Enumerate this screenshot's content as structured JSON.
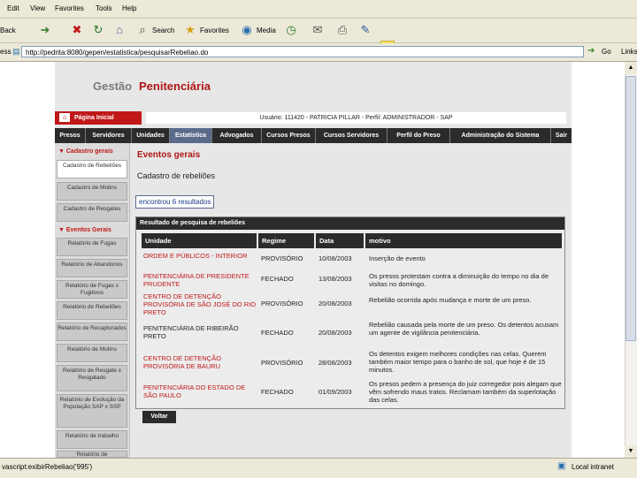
{
  "browser": {
    "menu": [
      "Edit",
      "View",
      "Favorites",
      "Tools",
      "Help"
    ],
    "toolbar": {
      "back_label": "Back",
      "search_label": "Search",
      "favorites_label": "Favorites",
      "media_label": "Media"
    },
    "address": {
      "label": "ess",
      "url": "http://pedrita:8080/gepen/estatistica/pesquisarRebeliao.do",
      "go_label": "Go",
      "links_label": "Links"
    },
    "status": {
      "text": "vascript:exibirRebeliao('995')",
      "zone": "Local intranet"
    }
  },
  "site": {
    "logo_gray": "Gestão",
    "logo_red": "Penitenciária",
    "home_label": "Página Inicial",
    "user_info": "Usuário: 111420 - PATRICIA PILLAR - Perfil: ADMINISTRADOR - SAP",
    "nav": [
      "Presos",
      "Servidores",
      "Unidades",
      "Estatística",
      "Advogados",
      "Cursos Presos",
      "Cursos Servidores",
      "Perfil do Preso",
      "Administração do Sistema",
      "Sair"
    ],
    "sidebar": {
      "section1": "Cadastro gerais",
      "section1_items": [
        "Cadastro de Rebeliões",
        "Cadastro de Motins",
        "Cadastro de Resgates"
      ],
      "section2": "Eventos Gerais",
      "section2_items": [
        "Relatório de Fugas",
        "Relatório de Abandonos",
        "Relatório de Fugas x Fugitivos",
        "Relatório de Rebeliões",
        "Relatório de Recapturados",
        "Relatório de Motins",
        "Relatório de Resgate x Resgatado",
        "Relatório de Evolução da População SAP x SSP",
        "Relatório de trabalho",
        "Relatório de"
      ]
    },
    "content": {
      "section_title": "Eventos gerais",
      "subtitle": "Cadastro de rebeliões",
      "found": "encontrou 6 resultados",
      "results_header": "Resultado de pesquisa de rebeliões",
      "columns": [
        "Unidade",
        "Regime",
        "Data",
        "motivo"
      ],
      "rows": [
        {
          "unidade": "ORDEM E PÚBLICOS - INTERIOR",
          "regime": "PROVISÓRIO",
          "data": "10/08/2003",
          "motivo": "Inserção de evento"
        },
        {
          "unidade": "PENITENCIÁRIA DE PRESIDENTE PRUDENTE",
          "regime": "FECHADO",
          "data": "13/08/2003",
          "motivo": "Os presos protestam contra a diminuição do tempo no dia de visitas no domingo."
        },
        {
          "unidade": "CENTRO DE DETENÇÃO PROVISÓRIA DE SÃO JOSÉ DO RIO PRETO",
          "regime": "PROVISÓRIO",
          "data": "20/08/2003",
          "motivo": "Rebelião ocorrida após mudança e morte de um preso."
        },
        {
          "unidade": "PENITENCIÁRIA DE RIBEIRÃO PRETO",
          "regime": "FECHADO",
          "data": "20/08/2003",
          "motivo": "Rebelião causada pela morte de um preso. Os detentos acusam um agente de vigilância penitenciária."
        },
        {
          "unidade": "CENTRO DE DETENÇÃO PROVISÓRIA DE BAURU",
          "regime": "PROVISÓRIO",
          "data": "28/08/2003",
          "motivo": "Os detentos exigem melhores condições nas celas. Querem também maior tempo para o banho de sol, que hoje é de 15 minutos."
        },
        {
          "unidade": "PENITENCIÁRIA DO ESTADO DE SÃO PAULO",
          "regime": "FECHADO",
          "data": "01/09/2003",
          "motivo": "Os presos pedem a presença do juiz corregedor pois alegam que vêm sofrendo maus tratos. Reclamam também da superlotação das celas."
        }
      ],
      "back_label": "Voltar"
    }
  }
}
